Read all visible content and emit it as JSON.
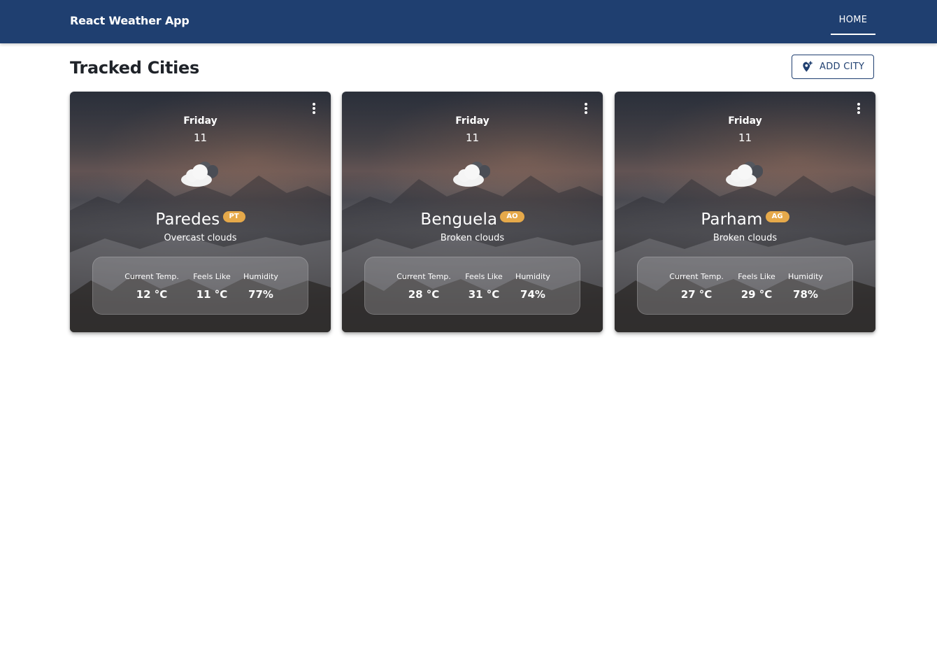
{
  "app": {
    "title": "React Weather App"
  },
  "nav": {
    "home_label": "HOME"
  },
  "page": {
    "title": "Tracked Cities",
    "add_city_label": "ADD CITY"
  },
  "stat_labels": {
    "current": "Current Temp.",
    "feels": "Feels Like",
    "humidity": "Humidity"
  },
  "cities": [
    {
      "day": "Friday",
      "date": "11",
      "icon": "broken-clouds-icon",
      "name": "Paredes",
      "country": "PT",
      "description": "Overcast clouds",
      "current_temp": "12 °C",
      "feels_like": "11 °C",
      "humidity": "77%"
    },
    {
      "day": "Friday",
      "date": "11",
      "icon": "broken-clouds-icon",
      "name": "Benguela",
      "country": "AO",
      "description": "Broken clouds",
      "current_temp": "28 °C",
      "feels_like": "31 °C",
      "humidity": "74%"
    },
    {
      "day": "Friday",
      "date": "11",
      "icon": "broken-clouds-icon",
      "name": "Parham",
      "country": "AG",
      "description": "Broken clouds",
      "current_temp": "27 °C",
      "feels_like": "29 °C",
      "humidity": "78%"
    }
  ],
  "colors": {
    "app_bar": "#1f3f70",
    "badge": "#e6a94a",
    "text_dark": "#1f2329"
  }
}
